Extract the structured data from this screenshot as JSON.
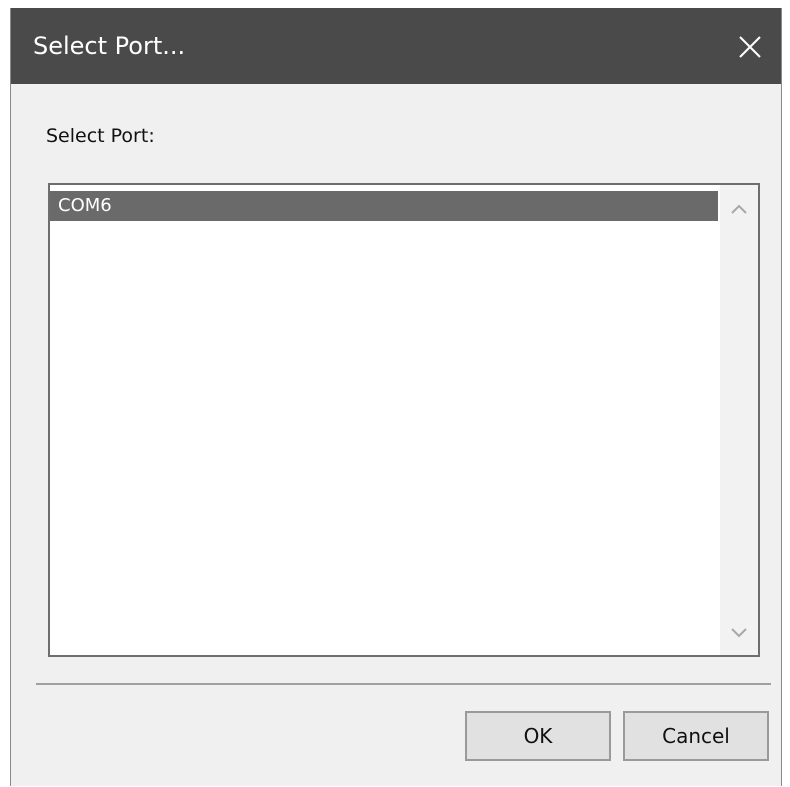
{
  "window": {
    "title": "Select Port...",
    "close_icon": "close-icon"
  },
  "prompt": {
    "label": "Select Port:"
  },
  "port_list": {
    "items": [
      {
        "label": "COM6",
        "selected": true
      }
    ],
    "scroll_up_icon": "chevron-up-icon",
    "scroll_down_icon": "chevron-down-icon"
  },
  "buttons": {
    "ok_label": "OK",
    "cancel_label": "Cancel"
  },
  "colors": {
    "titlebar": "#4a4a4a",
    "selection": "#6a6a6a",
    "dialog_bg": "#f0f0f0"
  }
}
